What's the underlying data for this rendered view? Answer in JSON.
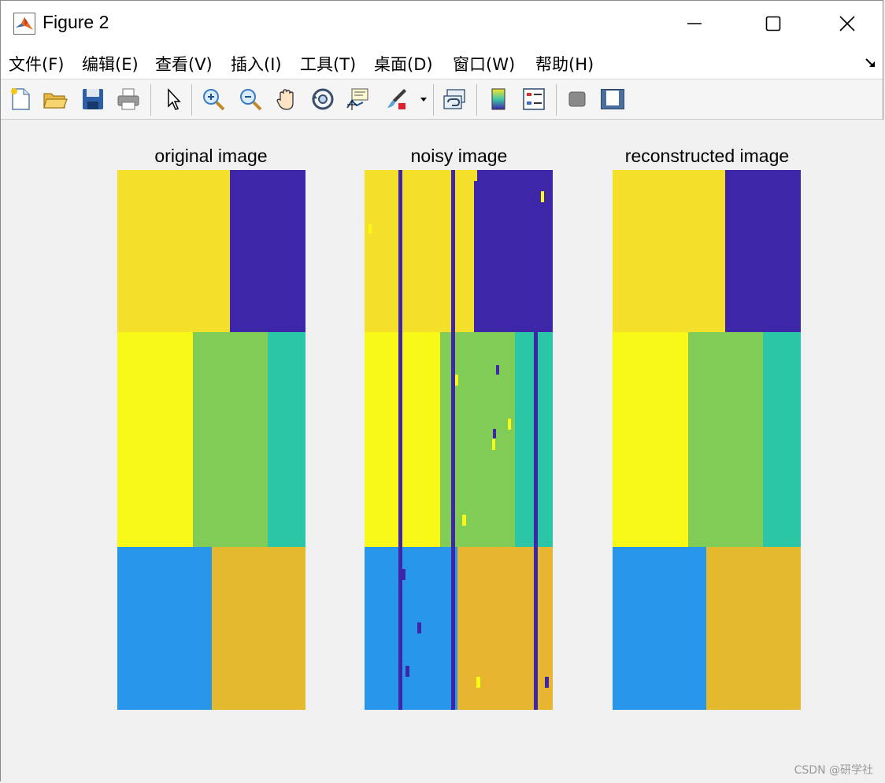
{
  "window": {
    "title": "Figure 2",
    "icon": "matlab-icon",
    "controls": [
      "minimize-icon",
      "maximize-icon",
      "close-icon"
    ]
  },
  "menu": {
    "items": [
      {
        "label": "文件(F)"
      },
      {
        "label": "编辑(E)"
      },
      {
        "label": "查看(V)"
      },
      {
        "label": "插入(I)"
      },
      {
        "label": "工具(T)"
      },
      {
        "label": "桌面(D)"
      },
      {
        "label": "窗口(W)"
      },
      {
        "label": "帮助(H)"
      }
    ],
    "dock_icon": "dock-arrow-icon"
  },
  "toolbar": {
    "buttons": [
      "new-figure-icon",
      "open-file-icon",
      "save-icon",
      "print-icon",
      "select-arrow-icon",
      "zoom-in-icon",
      "zoom-out-icon",
      "pan-hand-icon",
      "rotate-3d-icon",
      "data-cursor-icon",
      "brush-icon",
      "link-plot-icon",
      "colorbar-icon",
      "legend-icon",
      "hide-plot-tools-icon",
      "show-plot-tools-icon"
    ]
  },
  "plots": {
    "original": {
      "title": "original image"
    },
    "noisy": {
      "title": "noisy image"
    },
    "reconstructed": {
      "title": "reconstructed image"
    }
  },
  "colors": {
    "yellow_top": "#f4e02a",
    "purple": "#3e26a8",
    "bright_yellow": "#f8f917",
    "green": "#81cb57",
    "teal": "#2bc6a5",
    "blue": "#2897eb",
    "gold": "#e5b92e"
  },
  "watermark": "CSDN @研学社"
}
